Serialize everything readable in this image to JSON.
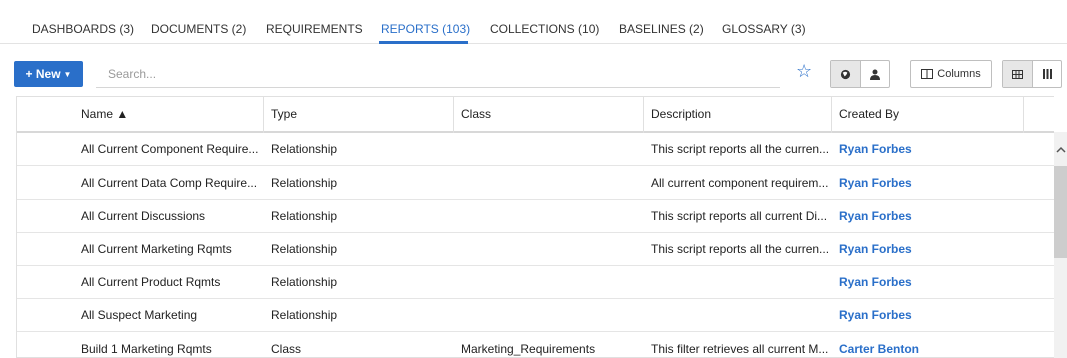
{
  "tabs": [
    {
      "label": "DASHBOARDS (3)"
    },
    {
      "label": "DOCUMENTS (2)"
    },
    {
      "label": "REQUIREMENTS"
    },
    {
      "label": "REPORTS (103)"
    },
    {
      "label": "COLLECTIONS (10)"
    },
    {
      "label": "BASELINES (2)"
    },
    {
      "label": "GLOSSARY (3)"
    }
  ],
  "active_tab": "REPORTS (103)",
  "toolbar": {
    "new_label": "+ New",
    "search_placeholder": "Search...",
    "columns_label": "Columns",
    "star_icon": "star-icon",
    "accent": "#2a6fc9"
  },
  "table": {
    "headers": {
      "name": "Name ▲",
      "type": "Type",
      "class": "Class",
      "description": "Description",
      "created_by": "Created By"
    },
    "rows": [
      {
        "name": "All Current Component Require...",
        "type": "Relationship",
        "class": "",
        "description": "This script reports all the curren...",
        "created_by": "Ryan Forbes"
      },
      {
        "name": "All Current Data Comp Require...",
        "type": "Relationship",
        "class": "",
        "description": "All current component requirem...",
        "created_by": "Ryan Forbes"
      },
      {
        "name": "All Current Discussions",
        "type": "Relationship",
        "class": "",
        "description": "This script reports all current Di...",
        "created_by": "Ryan Forbes"
      },
      {
        "name": "All Current Marketing Rqmts",
        "type": "Relationship",
        "class": "",
        "description": "This script reports all the curren...",
        "created_by": "Ryan Forbes"
      },
      {
        "name": "All Current Product Rqmts",
        "type": "Relationship",
        "class": "",
        "description": "",
        "created_by": "Ryan Forbes"
      },
      {
        "name": "All Suspect Marketing",
        "type": "Relationship",
        "class": "",
        "description": "",
        "created_by": "Ryan Forbes"
      },
      {
        "name": "Build 1 Marketing Rqmts",
        "type": "Class",
        "class": "Marketing_Requirements",
        "description": "This filter retrieves all current M...",
        "created_by": "Carter Benton"
      }
    ]
  }
}
